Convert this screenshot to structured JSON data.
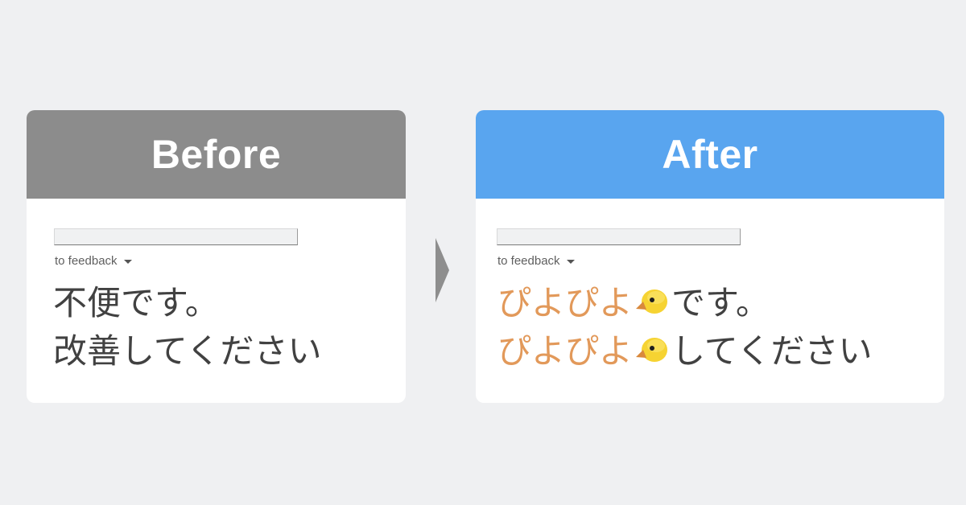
{
  "before": {
    "header": "Before",
    "input_value": "",
    "feedback_label": "to feedback",
    "lines": [
      [
        {
          "text": "不便です。",
          "style": "normal"
        }
      ],
      [
        {
          "text": "改善してください",
          "style": "normal"
        }
      ]
    ],
    "line1": "不便です。",
    "line2": "改善してください"
  },
  "after": {
    "header": "After",
    "input_value": "",
    "feedback_label": "to feedback",
    "line1_highlight": "ぴよぴよ",
    "line1_rest": "です。",
    "line2_highlight": "ぴよぴよ",
    "line2_rest": "してください",
    "emoji": "baby-chick-icon"
  },
  "colors": {
    "background": "#eff0f2",
    "before_header": "#8c8c8c",
    "after_header": "#59a5ef",
    "highlight_text": "#e2995a",
    "body_text": "#414141",
    "arrow": "#8e8e8e"
  }
}
